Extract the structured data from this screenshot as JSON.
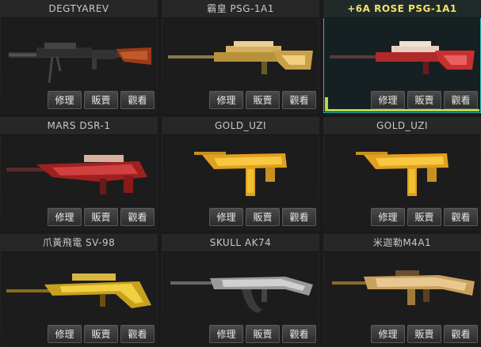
{
  "colors": {
    "selected_border": "#2bb8b0",
    "selected_title": "#f5e06a",
    "selected_accent": "#b8d84a"
  },
  "weapons": [
    {
      "name": "DEGTYAREV",
      "icon": "lmg-black-icon",
      "selected": false,
      "buttons": [
        "修理",
        "販賣",
        "觀看"
      ]
    },
    {
      "name": "霸皇 PSG-1A1",
      "icon": "sniper-gold-icon",
      "selected": false,
      "buttons": [
        "修理",
        "販賣",
        "觀看"
      ]
    },
    {
      "name": "+6A ROSE PSG-1A1",
      "icon": "sniper-rose-icon",
      "selected": true,
      "buttons": [
        "修理",
        "販賣",
        "觀看"
      ]
    },
    {
      "name": "MARS DSR-1",
      "icon": "sniper-red-icon",
      "selected": false,
      "buttons": [
        "修理",
        "販賣",
        "觀看"
      ]
    },
    {
      "name": "GOLD_UZI",
      "icon": "smg-gold-icon",
      "selected": false,
      "buttons": [
        "修理",
        "販賣",
        "觀看"
      ]
    },
    {
      "name": "GOLD_UZI",
      "icon": "smg-gold-icon",
      "selected": false,
      "buttons": [
        "修理",
        "販賣",
        "觀看"
      ]
    },
    {
      "name": "爪黃飛電 SV-98",
      "icon": "sniper-yellow-icon",
      "selected": false,
      "buttons": [
        "修理",
        "販賣",
        "觀看"
      ]
    },
    {
      "name": "SKULL AK74",
      "icon": "rifle-silver-icon",
      "selected": false,
      "buttons": [
        "修理",
        "販賣",
        "觀看"
      ]
    },
    {
      "name": "米迦勒M4A1",
      "icon": "rifle-gold-icon",
      "selected": false,
      "buttons": [
        "修理",
        "販賣",
        "觀看"
      ]
    }
  ]
}
